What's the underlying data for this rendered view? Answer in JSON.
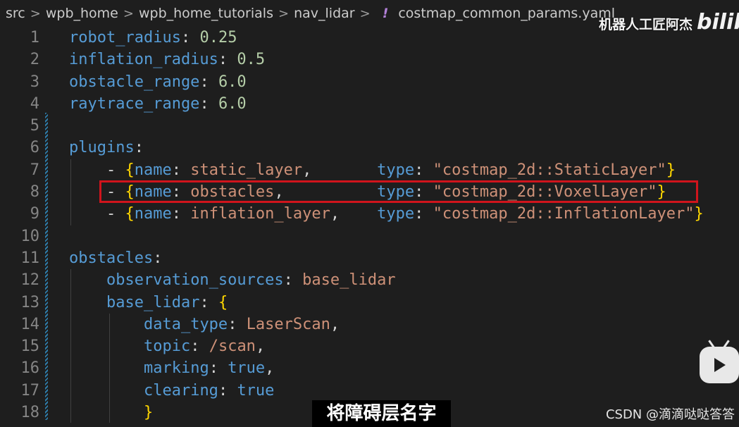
{
  "breadcrumb": {
    "items": [
      "src",
      "wpb_home",
      "wpb_home_tutorials",
      "nav_lidar"
    ],
    "file_icon": "!",
    "file": "costmap_common_params.yaml"
  },
  "watermark": "机器人工匠阿杰",
  "bili_logo": "bilib",
  "lines": [
    {
      "n": "1",
      "t": [
        [
          "k",
          "robot_radius"
        ],
        [
          "p",
          ": "
        ],
        [
          "n",
          "0.25"
        ]
      ]
    },
    {
      "n": "2",
      "t": [
        [
          "k",
          "inflation_radius"
        ],
        [
          "p",
          ": "
        ],
        [
          "n",
          "0.5"
        ]
      ]
    },
    {
      "n": "3",
      "t": [
        [
          "k",
          "obstacle_range"
        ],
        [
          "p",
          ": "
        ],
        [
          "n",
          "6.0"
        ]
      ]
    },
    {
      "n": "4",
      "t": [
        [
          "k",
          "raytrace_range"
        ],
        [
          "p",
          ": "
        ],
        [
          "n",
          "6.0"
        ]
      ]
    },
    {
      "n": "5",
      "t": []
    },
    {
      "n": "6",
      "t": [
        [
          "k",
          "plugins"
        ],
        [
          "p",
          ":"
        ]
      ]
    },
    {
      "n": "7",
      "t": [
        [
          "p",
          "    - "
        ],
        [
          "b",
          "{"
        ],
        [
          "k",
          "name"
        ],
        [
          "p",
          ": "
        ],
        [
          "s",
          "static_layer"
        ],
        [
          "p",
          ",       "
        ],
        [
          "k",
          "type"
        ],
        [
          "p",
          ": "
        ],
        [
          "s",
          "\"costmap_2d::StaticLayer\""
        ],
        [
          "b",
          "}"
        ]
      ]
    },
    {
      "n": "8",
      "t": [
        [
          "p",
          "    - "
        ],
        [
          "b",
          "{"
        ],
        [
          "k",
          "name"
        ],
        [
          "p",
          ": "
        ],
        [
          "s",
          "obstacles"
        ],
        [
          "p",
          ",          "
        ],
        [
          "k",
          "type"
        ],
        [
          "p",
          ": "
        ],
        [
          "s",
          "\"costmap_2d::VoxelLayer\""
        ],
        [
          "b",
          "}"
        ]
      ]
    },
    {
      "n": "9",
      "t": [
        [
          "p",
          "    - "
        ],
        [
          "b",
          "{"
        ],
        [
          "k",
          "name"
        ],
        [
          "p",
          ": "
        ],
        [
          "s",
          "inflation_layer"
        ],
        [
          "p",
          ",    "
        ],
        [
          "k",
          "type"
        ],
        [
          "p",
          ": "
        ],
        [
          "s",
          "\"costmap_2d::InflationLayer\""
        ],
        [
          "b",
          "}"
        ]
      ]
    },
    {
      "n": "10",
      "t": []
    },
    {
      "n": "11",
      "t": [
        [
          "k",
          "obstacles"
        ],
        [
          "p",
          ":"
        ]
      ]
    },
    {
      "n": "12",
      "t": [
        [
          "p",
          "    "
        ],
        [
          "k",
          "observation_sources"
        ],
        [
          "p",
          ": "
        ],
        [
          "s",
          "base_lidar"
        ]
      ]
    },
    {
      "n": "13",
      "t": [
        [
          "p",
          "    "
        ],
        [
          "k",
          "base_lidar"
        ],
        [
          "p",
          ": "
        ],
        [
          "b",
          "{"
        ]
      ]
    },
    {
      "n": "14",
      "t": [
        [
          "p",
          "        "
        ],
        [
          "k",
          "data_type"
        ],
        [
          "p",
          ": "
        ],
        [
          "s",
          "LaserScan"
        ],
        [
          "p",
          ","
        ]
      ]
    },
    {
      "n": "15",
      "t": [
        [
          "p",
          "        "
        ],
        [
          "k",
          "topic"
        ],
        [
          "p",
          ": "
        ],
        [
          "s",
          "/scan"
        ],
        [
          "p",
          ","
        ]
      ]
    },
    {
      "n": "16",
      "t": [
        [
          "p",
          "        "
        ],
        [
          "k",
          "marking"
        ],
        [
          "p",
          ": "
        ],
        [
          "k",
          "true"
        ],
        [
          "p",
          ","
        ]
      ]
    },
    {
      "n": "17",
      "t": [
        [
          "p",
          "        "
        ],
        [
          "k",
          "clearing"
        ],
        [
          "p",
          ": "
        ],
        [
          "k",
          "true"
        ]
      ]
    },
    {
      "n": "18",
      "t": [
        [
          "p",
          "        "
        ],
        [
          "b",
          "}"
        ]
      ]
    }
  ],
  "subtitle": "将障碍层名字",
  "csdn": "CSDN @滴滴哒哒答答",
  "colors": {
    "keyword": "#569cd6",
    "number": "#b5cea8",
    "string": "#ce9178",
    "bracket": "#ffd700",
    "highlight": "#d0141c"
  }
}
